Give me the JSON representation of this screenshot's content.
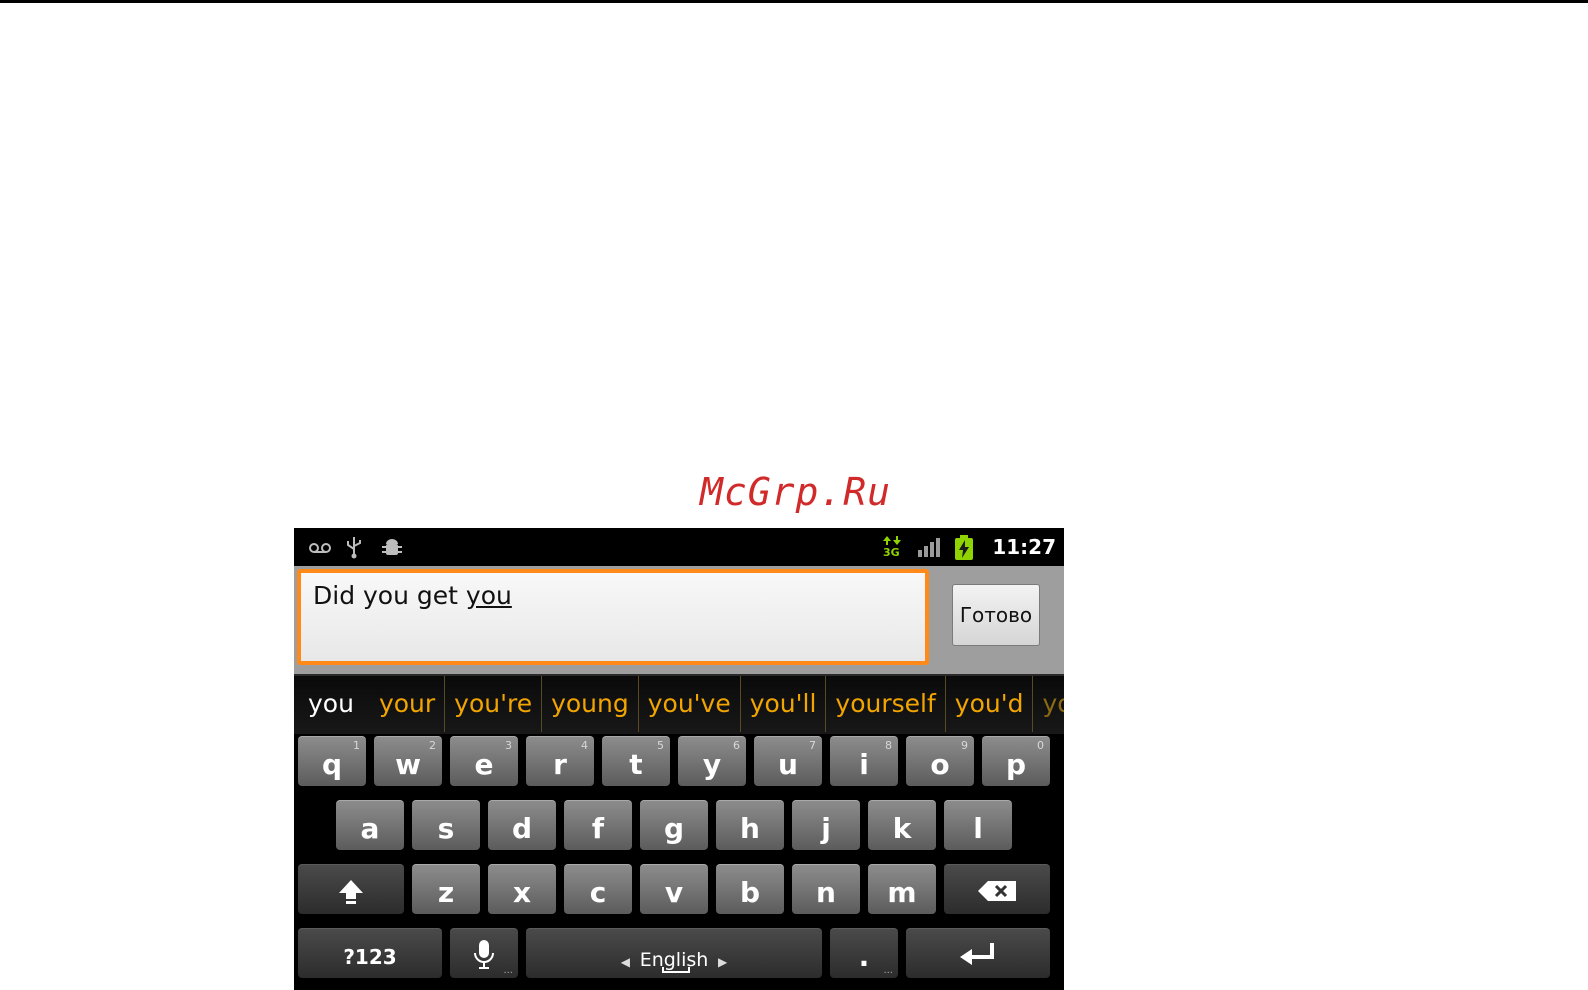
{
  "watermark": "McGrp.Ru",
  "status_bar": {
    "time": "11:27",
    "left_icons": [
      "voicemail-icon",
      "usb-icon",
      "android-debug-icon"
    ],
    "right_icons": [
      "data-3g-icon",
      "signal-icon",
      "battery-charging-icon"
    ],
    "network_label": "3G"
  },
  "input": {
    "text_before": "Did you get ",
    "composing_word": "you",
    "done_label": "Готово"
  },
  "suggestions": [
    "you",
    "your",
    "you're",
    "young",
    "you've",
    "you'll",
    "yourself",
    "you'd",
    "your"
  ],
  "keyboard": {
    "row1": [
      {
        "label": "q",
        "hint": "1"
      },
      {
        "label": "w",
        "hint": "2"
      },
      {
        "label": "e",
        "hint": "3"
      },
      {
        "label": "r",
        "hint": "4"
      },
      {
        "label": "t",
        "hint": "5"
      },
      {
        "label": "y",
        "hint": "6"
      },
      {
        "label": "u",
        "hint": "7"
      },
      {
        "label": "i",
        "hint": "8"
      },
      {
        "label": "o",
        "hint": "9"
      },
      {
        "label": "p",
        "hint": "0"
      }
    ],
    "row2": [
      "a",
      "s",
      "d",
      "f",
      "g",
      "h",
      "j",
      "k",
      "l"
    ],
    "row3": [
      "z",
      "x",
      "c",
      "v",
      "b",
      "n",
      "m"
    ],
    "symbols_label": "?123",
    "language_label": "English",
    "period_label": ".",
    "more_dots": "..."
  },
  "colors": {
    "accent_orange": "#ff8a1a",
    "suggestion_text": "#f2a500",
    "battery_green": "#8fd400",
    "watermark_red": "#d02a2a"
  }
}
